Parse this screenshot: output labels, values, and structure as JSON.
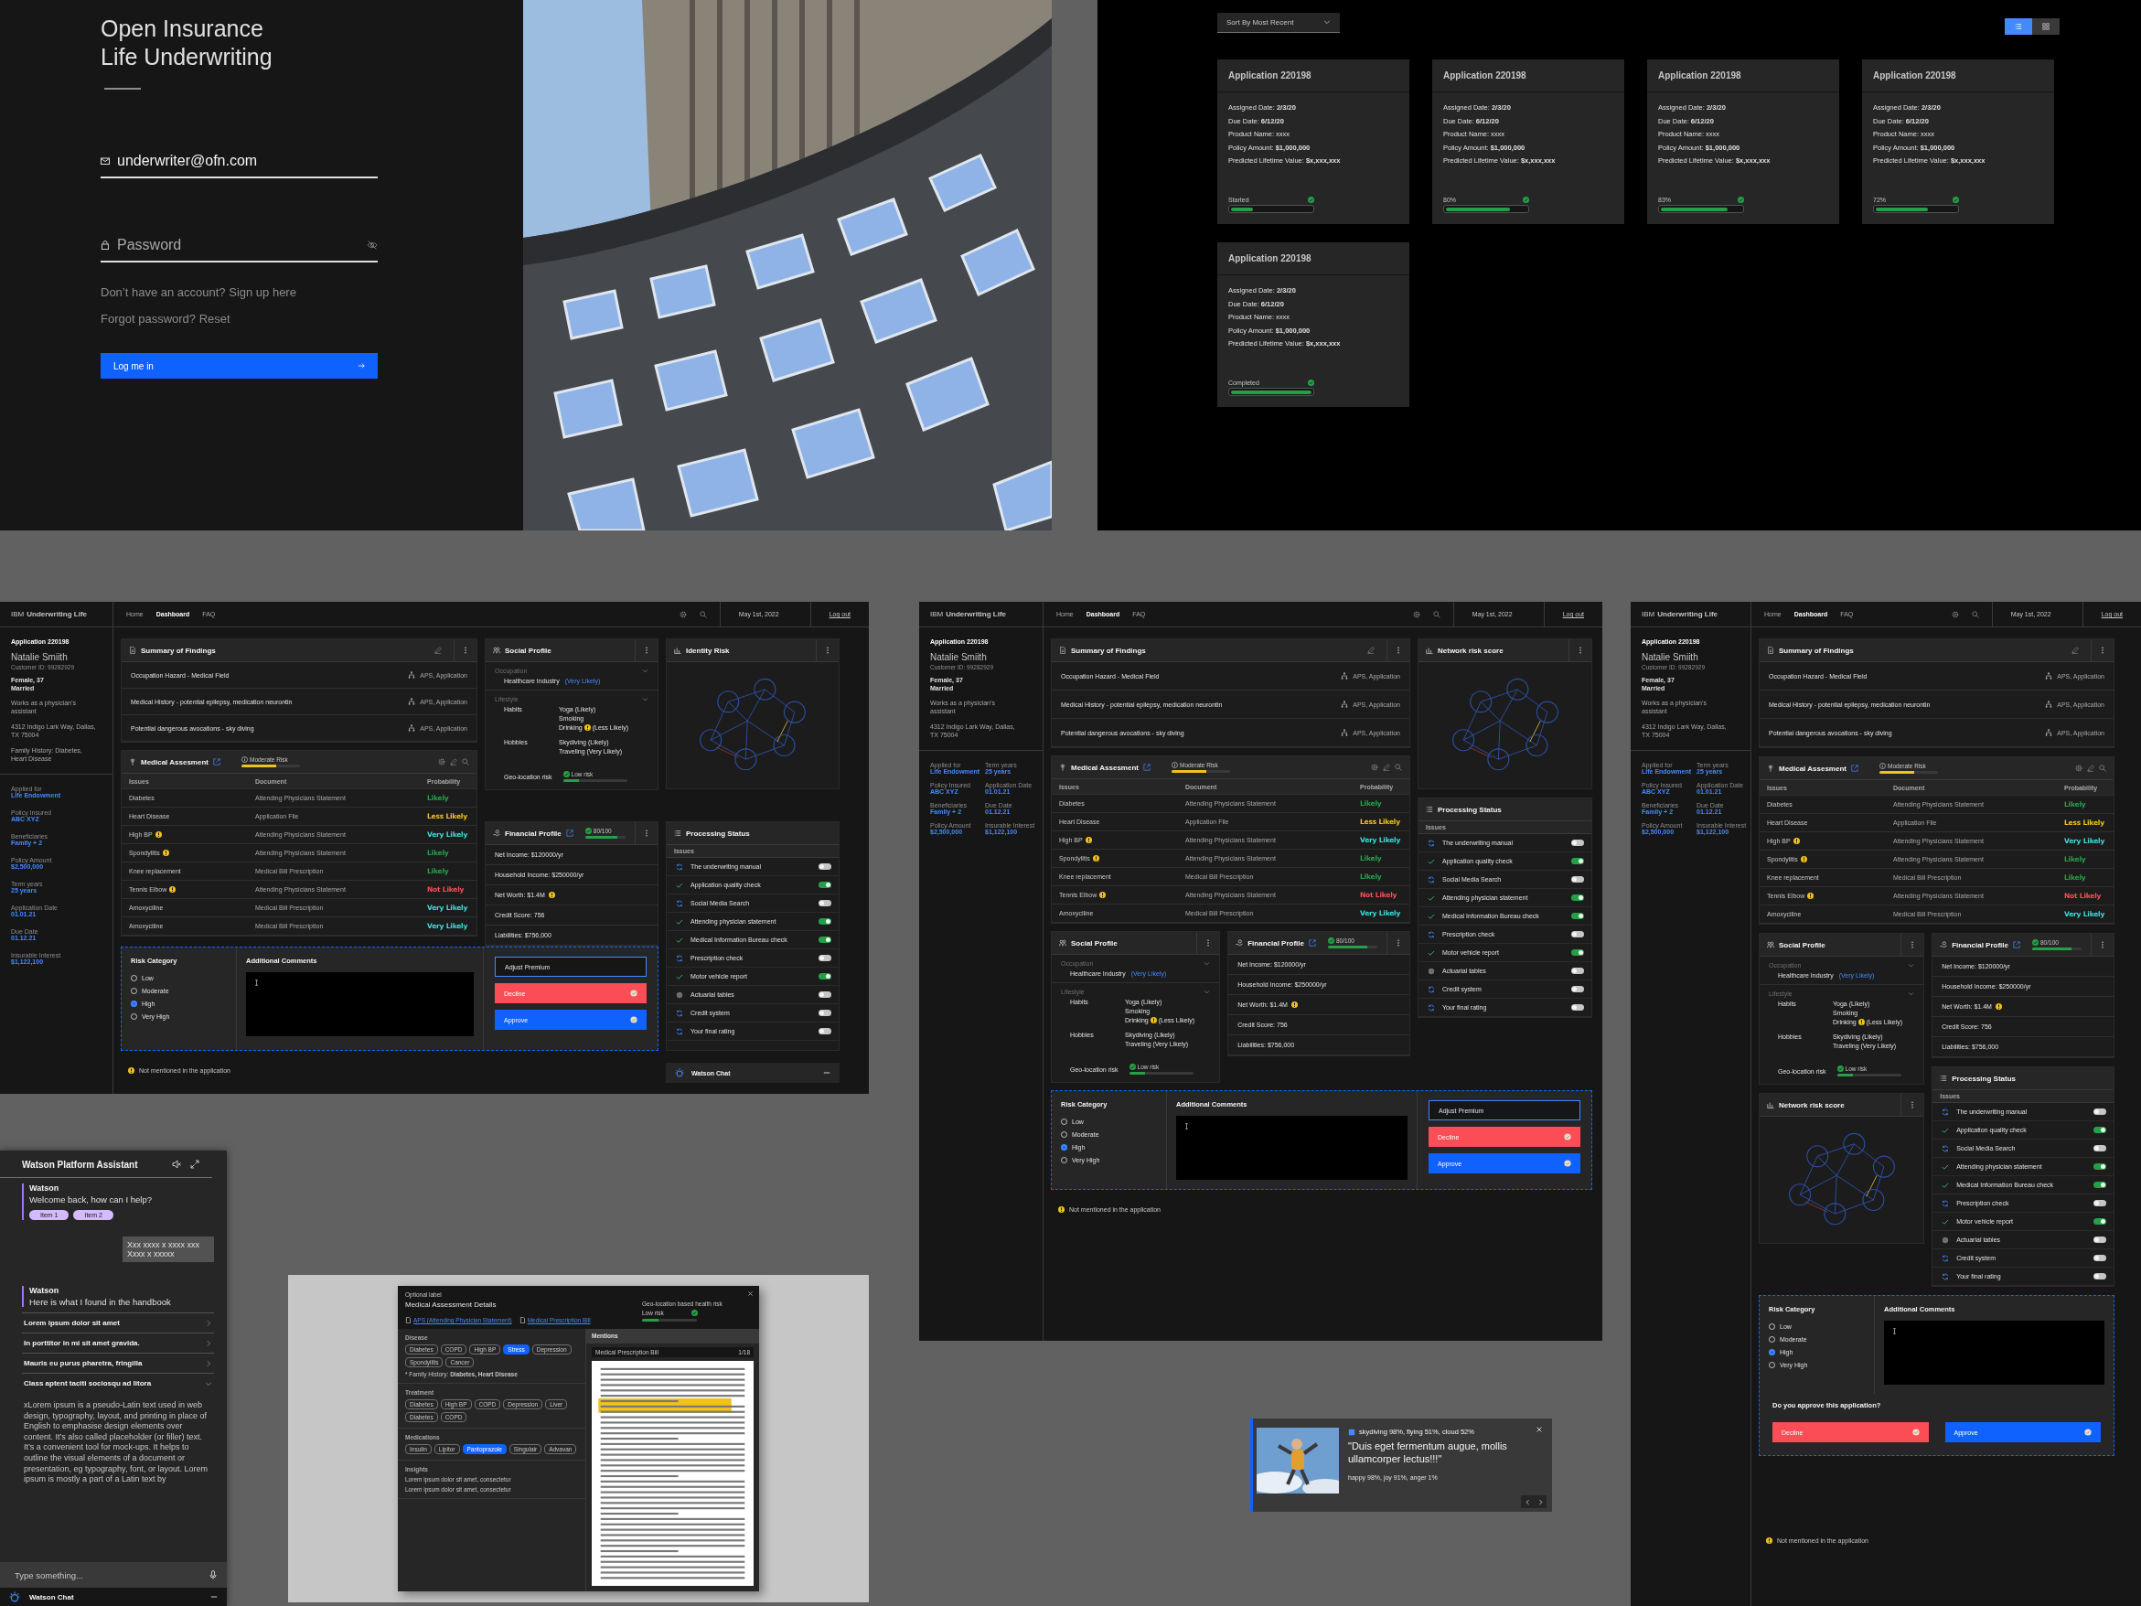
{
  "login": {
    "title_lines": [
      "Open Insurance",
      "Life Underwriting"
    ],
    "email": "underwriter@ofn.com",
    "password_placeholder": "Password",
    "links": [
      "Don’t have an account? Sign up here",
      "Forgot password? Reset"
    ],
    "button": "Log me in"
  },
  "applications": {
    "sort": "Sort By Most Recent",
    "views": [
      {
        "kind": "list",
        "selected": true
      },
      {
        "kind": "grid",
        "selected": false
      }
    ],
    "cards": [
      {
        "title": "Application 220198",
        "fields": [
          "Assigned Date: **2/3/20**",
          "Due Date: **6/12/20**",
          "Product Name: xxxx",
          "Policy Amount: **$1,000,000**",
          "Predicted Lifetime Value: **$x,xxx,xxx**"
        ],
        "progress": "Started",
        "level": 0.27
      },
      {
        "title": "Application 220198",
        "fields": [
          "Assigned Date: **2/3/20**",
          "Due Date: **6/12/20**",
          "Product Name: xxxx",
          "Policy Amount: **$1,000,000**",
          "Predicted Lifetime Value: **$x,xxx,xxx**"
        ],
        "progress": "80%",
        "level": 0.8
      },
      {
        "title": "Application 220198",
        "fields": [
          "Assigned Date: **2/3/20**",
          "Due Date: **6/12/20**",
          "Product Name: xxxx",
          "Policy Amount: **$1,000,000**",
          "Predicted Lifetime Value: **$x,xxx,xxx**"
        ],
        "progress": "83%",
        "level": 0.83
      },
      {
        "title": "Application 220198",
        "fields": [
          "Assigned Date: **2/3/20**",
          "Due Date: **6/12/20**",
          "Product Name: xxxx",
          "Policy Amount: **$1,000,000**",
          "Predicted Lifetime Value: **$x,xxx,xxx**"
        ],
        "progress": "72%",
        "level": 0.65
      },
      {
        "title": "Application 220198",
        "fields": [
          "Assigned Date: **2/3/20**",
          "Due Date: **6/12/20**",
          "Product Name: xxxx",
          "Policy Amount: **$1,000,000**",
          "Predicted Lifetime Value: **$x,xxx,xxx**"
        ],
        "progress": "Completed",
        "level": 1
      }
    ]
  },
  "dashboards": [
    {
      "kind": "wide",
      "nav": {
        "brand": "IBM **Underwriting Life**",
        "links": [
          {
            "label": "Home",
            "selected": false
          },
          {
            "label": "Dashboard",
            "selected": true
          },
          {
            "label": "FAQ",
            "selected": false
          }
        ],
        "date": "May 1st, 2022",
        "logout": "Log out"
      },
      "sidebar": {
        "application": "Application 220198",
        "name": "Natalie Smiith",
        "customer_id": "Customer ID: 99282929",
        "details": [
          "Female, 37",
          "Married"
        ],
        "occupation": "Works as a physician’s assistant",
        "address": "4312 Indigo Lark Way, Dallas, TX 75004",
        "family_history": "Family History: Diabetes, Heart Disease",
        "fields": [
          {
            "label": "Applied for",
            "value": "Life Endowment"
          },
          {
            "label": "Policy Insured",
            "value": "ABC XYZ"
          },
          {
            "label": "Beneficiaries",
            "value": "Family + 2"
          },
          {
            "label": "Policy Amount",
            "value": "$2,500,000"
          },
          {
            "label": "Term years",
            "value": "25 years"
          },
          {
            "label": "Application Date",
            "value": "01.01.21"
          },
          {
            "label": "Due Date",
            "value": "01.12.21"
          },
          {
            "label": "Insurable Interest",
            "value": "$1,122,100"
          }
        ]
      },
      "findings": {
        "title": "Summary of Findings",
        "rows": [
          {
            "text": "Occupation Hazard - Medical Field",
            "source": "APS, Application"
          },
          {
            "text": "Medical History - potential epilepsy, medication neurontin",
            "source": "APS, Application"
          },
          {
            "text": "Potential dangerous avocations - sky diving",
            "source": "APS, Application"
          }
        ]
      },
      "medical": {
        "title": "Medical Assesment",
        "risk": {
          "label": "Moderate Risk",
          "level": 0.6
        },
        "columns": [
          "Issues",
          "Document",
          "Probability"
        ],
        "rows": [
          {
            "issue": "Diabetes",
            "warning": false,
            "document": "Attending Physicians Statement",
            "probability": "Likely",
            "color": "#24a148"
          },
          {
            "issue": "Heart Disease",
            "warning": false,
            "document": "Application File",
            "probability": "Less Likely",
            "color": "#f1c21b"
          },
          {
            "issue": "High BP",
            "warning": true,
            "document": "Attending Physicians Statement",
            "probability": "Very Likely",
            "color": "#3ddbd9"
          },
          {
            "issue": "Spondylitis",
            "warning": true,
            "document": "Attending Physicians Statement",
            "probability": "Likely",
            "color": "#24a148"
          },
          {
            "issue": "Knee replacement",
            "warning": false,
            "document": "Medical Bill Prescription",
            "probability": "Likely",
            "color": "#24a148"
          },
          {
            "issue": "Tennis Elbow",
            "warning": true,
            "document": "Attending Physicians Statement",
            "probability": "Not Likely",
            "color": "#fa4d56"
          },
          {
            "issue": "Amoxyciline",
            "warning": false,
            "document": "Medical Bill Prescription",
            "probability": "Very Likely",
            "color": "#3ddbd9"
          },
          {
            "issue": "Amoxyciline",
            "warning": false,
            "document": "Medical Bill Prescription",
            "probability": "Very Likely",
            "color": "#3ddbd9"
          }
        ]
      },
      "social": {
        "title": "Social Profile",
        "occupation_label": "Occupation",
        "occupation": "Healthcare Industry",
        "occupation_note": "(Very Likely)",
        "lifestyle_label": "Lifestyle",
        "groups": [
          {
            "label": "Habits",
            "items": [
              {
                "text": "Yoga (Likely)",
                "warning": false
              },
              {
                "text": "Smoking",
                "warning": false
              },
              {
                "text": "Drinking",
                "warning": true,
                "note": "(Less Likely)"
              }
            ]
          },
          {
            "label": "Hobbies",
            "items": [
              {
                "text": "Skydiving (Likely)",
                "warning": false
              },
              {
                "text": "Traveling  (Very Likely)",
                "warning": false
              }
            ]
          }
        ],
        "geo": {
          "label": "Geo-location risk",
          "risk": "Low risk",
          "level": 0.25
        }
      },
      "financial": {
        "title": "Financial Profile",
        "score": "80/100",
        "level": 0.8,
        "rows": [
          {
            "text": "Net Income: $120000/yr",
            "warning": false
          },
          {
            "text": "Household Income: $250000/yr",
            "warning": false
          },
          {
            "text": "Net Worth: $1.4M",
            "warning": true
          },
          {
            "text": "Credit Score: 756",
            "warning": false
          },
          {
            "text": "Liabilities: $756,000",
            "warning": false
          }
        ]
      },
      "network": {
        "title": "Identity Risk"
      },
      "processing": {
        "title": "Processing Status",
        "header": "Issues",
        "items": [
          {
            "label": "The underwriting manual",
            "kind": "sync",
            "on": false
          },
          {
            "label": "Application quality check",
            "kind": "done",
            "on": true
          },
          {
            "label": "Social Media Search",
            "kind": "sync",
            "on": false
          },
          {
            "label": "Attending physician statement",
            "kind": "done",
            "on": true
          },
          {
            "label": "Medical Information Bureau check",
            "kind": "done",
            "on": true
          },
          {
            "label": "Prescription check",
            "kind": "sync",
            "on": false
          },
          {
            "label": "Motor vehicle report",
            "kind": "done",
            "on": true
          },
          {
            "label": "Actuarial tables",
            "kind": "pending",
            "on": false
          },
          {
            "label": "Credit system",
            "kind": "sync",
            "on": false
          },
          {
            "label": "Your final rating",
            "kind": "sync",
            "on": false
          }
        ]
      },
      "decision": {
        "risk_title": "Risk Category",
        "options": [
          {
            "label": "Low",
            "selected": false
          },
          {
            "label": "Moderate",
            "selected": false
          },
          {
            "label": "High",
            "selected": true
          },
          {
            "label": "Very High",
            "selected": false
          }
        ],
        "comments_title": "Additional Comments",
        "buttons": [
          {
            "kind": "outline",
            "label": "Adjust Premium"
          },
          {
            "kind": "danger",
            "label": "Decline"
          },
          {
            "kind": "primary",
            "label": "Approve"
          }
        ]
      },
      "footnote": "Not mentioned in the application",
      "chat": "Watson Chat"
    },
    {
      "kind": "stack",
      "nav": {
        "brand": "IBM **Underwriting Life**",
        "links": [
          {
            "label": "Home",
            "selected": false
          },
          {
            "label": "Dashboard",
            "selected": true
          },
          {
            "label": "FAQ",
            "selected": false
          }
        ],
        "date": "May 1st, 2022",
        "logout": "Log out"
      },
      "sidebar": {
        "application": "Application 220198",
        "name": "Natalie Smiith",
        "customer_id": "Customer ID: 99282929",
        "details": [
          "Female, 37",
          "Married"
        ],
        "occupation": "Works as a physician’s assistant",
        "address": "4312 Indigo Lark Way, Dallas, TX 75004",
        "fields": [
          {
            "label": "Applied for",
            "value": "Life Endowment"
          },
          {
            "label": "Policy Insured",
            "value": "ABC XYZ"
          },
          {
            "label": "Beneficiaries",
            "value": "Family + 2"
          },
          {
            "label": "Policy Amount",
            "value": "$2,500,000"
          },
          {
            "label": "Term years",
            "value": "25 years"
          },
          {
            "label": "Application Date",
            "value": "01.01.21"
          },
          {
            "label": "Due Date",
            "value": "01.12.21"
          },
          {
            "label": "Insurable Interest",
            "value": "$1,122,100"
          }
        ]
      },
      "findings": {
        "title": "Summary of Findings",
        "rows": [
          {
            "text": "Occupation Hazard - Medical Field",
            "source": "APS, Application"
          },
          {
            "text": "Medical History - potential epilepsy, medication neurontin",
            "source": "APS, Application"
          },
          {
            "text": "Potential dangerous avocations - sky diving",
            "source": "APS, Application"
          }
        ]
      },
      "medical": {
        "title": "Medical Assesment",
        "risk": {
          "label": "Moderate Risk",
          "level": 0.6
        },
        "columns": [
          "Issues",
          "Document",
          "Probability"
        ],
        "rows": [
          {
            "issue": "Diabetes",
            "warning": false,
            "document": "Attending Physicians Statement",
            "probability": "Likely",
            "color": "#24a148"
          },
          {
            "issue": "Heart Disease",
            "warning": false,
            "document": "Application File",
            "probability": "Less Likely",
            "color": "#f1c21b"
          },
          {
            "issue": "High BP",
            "warning": true,
            "document": "Attending Physicians Statement",
            "probability": "Very Likely",
            "color": "#3ddbd9"
          },
          {
            "issue": "Spondylitis",
            "warning": true,
            "document": "Attending Physicians Statement",
            "probability": "Likely",
            "color": "#24a148"
          },
          {
            "issue": "Knee replacement",
            "warning": false,
            "document": "Medical Bill Prescription",
            "probability": "Likely",
            "color": "#24a148"
          },
          {
            "issue": "Tennis Elbow",
            "warning": true,
            "document": "Attending Physicians Statement",
            "probability": "Not Likely",
            "color": "#fa4d56"
          },
          {
            "issue": "Amoxyciline",
            "warning": false,
            "document": "Medical Bill Prescription",
            "probability": "Very Likely",
            "color": "#3ddbd9"
          }
        ]
      },
      "social": {
        "title": "Social Profile",
        "occupation_label": "Occupation",
        "occupation": "Healthcare Industry",
        "occupation_note": "(Very Likely)",
        "lifestyle_label": "Lifestyle",
        "groups": [
          {
            "label": "Habits",
            "items": [
              {
                "text": "Yoga (Likely)",
                "warning": false
              },
              {
                "text": "Smoking",
                "warning": false
              },
              {
                "text": "Drinking",
                "warning": true,
                "note": "(Less Likely)"
              }
            ]
          },
          {
            "label": "Hobbies",
            "items": [
              {
                "text": "Skydiving (Likely)",
                "warning": false
              },
              {
                "text": "Traveling  (Very Likely)",
                "warning": false
              }
            ]
          }
        ],
        "geo": {
          "label": "Geo-location risk",
          "risk": "Low risk",
          "level": 0.25
        }
      },
      "financial": {
        "title": "Financial Profile",
        "score": "80/100",
        "level": 0.8,
        "rows": [
          {
            "text": "Net Income: $120000/yr",
            "warning": false
          },
          {
            "text": "Household Income: $250000/yr",
            "warning": false
          },
          {
            "text": "Net Worth: $1.4M",
            "warning": true
          },
          {
            "text": "Credit Score: 756",
            "warning": false
          },
          {
            "text": "Liabilities: $756,000",
            "warning": false
          }
        ]
      },
      "network": {
        "title": "Network risk score"
      },
      "processing": {
        "title": "Processing Status",
        "header": "Issues",
        "items": [
          {
            "label": "The underwriting manual",
            "kind": "sync",
            "on": false
          },
          {
            "label": "Application quality check",
            "kind": "done",
            "on": true
          },
          {
            "label": "Social Media Search",
            "kind": "sync",
            "on": false
          },
          {
            "label": "Attending physician statement",
            "kind": "done",
            "on": true
          },
          {
            "label": "Medical Information Bureau check",
            "kind": "done",
            "on": true
          },
          {
            "label": "Prescription check",
            "kind": "sync",
            "on": false
          },
          {
            "label": "Motor vehicle report",
            "kind": "done",
            "on": true
          },
          {
            "label": "Actuarial tables",
            "kind": "pending",
            "on": false
          },
          {
            "label": "Credit system",
            "kind": "sync",
            "on": false
          },
          {
            "label": "Your final rating",
            "kind": "sync",
            "on": false
          }
        ]
      },
      "decision": {
        "risk_title": "Risk Category",
        "options": [
          {
            "label": "Low",
            "selected": false
          },
          {
            "label": "Moderate",
            "selected": false
          },
          {
            "label": "High",
            "selected": true
          },
          {
            "label": "Very High",
            "selected": false
          }
        ],
        "comments_title": "Additional Comments",
        "buttons": [
          {
            "kind": "outline",
            "label": "Adjust Premium"
          },
          {
            "kind": "danger",
            "label": "Decline"
          },
          {
            "kind": "primary",
            "label": "Approve"
          }
        ]
      },
      "footnote": "Not mentioned in the application"
    },
    {
      "kind": "narrow",
      "nav": {
        "brand": "IBM **Underwriting Life**",
        "links": [
          {
            "label": "Home",
            "selected": false
          },
          {
            "label": "Dashboard",
            "selected": true
          },
          {
            "label": "FAQ",
            "selected": false
          }
        ],
        "date": "May 1st, 2022",
        "logout": "Log out"
      },
      "sidebar": {
        "application": "Application 220198",
        "name": "Natalie Smiith",
        "customer_id": "Customer ID: 99282929",
        "details": [
          "Female, 37",
          "Married"
        ],
        "occupation": "Works as a physician’s assistant",
        "address": "4312 Indigo Lark Way, Dallas, TX 75004",
        "fields": [
          {
            "label": "Applied for",
            "value": "Life Endowment"
          },
          {
            "label": "Policy Insured",
            "value": "ABC XYZ"
          },
          {
            "label": "Beneficiaries",
            "value": "Family + 2"
          },
          {
            "label": "Policy Amount",
            "value": "$2,500,000"
          },
          {
            "label": "Term years",
            "value": "25 years"
          },
          {
            "label": "Application Date",
            "value": "01.01.21"
          },
          {
            "label": "Due Date",
            "value": "01.12.21"
          },
          {
            "label": "Insurable Interest",
            "value": "$1,122,100"
          }
        ]
      },
      "findings": {
        "title": "Summary of Findings",
        "rows": [
          {
            "text": "Occupation Hazard - Medical Field",
            "source": "APS, Application"
          },
          {
            "text": "Medical History - potential epilepsy, medication neurontin",
            "source": "APS, Application"
          },
          {
            "text": "Potential dangerous avocations - sky diving",
            "source": "APS, Application"
          }
        ]
      },
      "medical": {
        "title": "Medical Assesment",
        "risk": {
          "label": "Moderate Risk",
          "level": 0.6
        },
        "columns": [
          "Issues",
          "Document",
          "Probability"
        ],
        "rows": [
          {
            "issue": "Diabetes",
            "warning": false,
            "document": "Attending Physicians Statement",
            "probability": "Likely",
            "color": "#24a148"
          },
          {
            "issue": "Heart Disease",
            "warning": false,
            "document": "Application File",
            "probability": "Less Likely",
            "color": "#f1c21b"
          },
          {
            "issue": "High BP",
            "warning": true,
            "document": "Attending Physicians Statement",
            "probability": "Very Likely",
            "color": "#3ddbd9"
          },
          {
            "issue": "Spondylitis",
            "warning": true,
            "document": "Attending Physicians Statement",
            "probability": "Likely",
            "color": "#24a148"
          },
          {
            "issue": "Knee replacement",
            "warning": false,
            "document": "Medical Bill Prescription",
            "probability": "Likely",
            "color": "#24a148"
          },
          {
            "issue": "Tennis Elbow",
            "warning": true,
            "document": "Attending Physicians Statement",
            "probability": "Not Likely",
            "color": "#fa4d56"
          },
          {
            "issue": "Amoxyciline",
            "warning": false,
            "document": "Medical Bill Prescription",
            "probability": "Very Likely",
            "color": "#3ddbd9"
          }
        ]
      },
      "social": {
        "title": "Social Profile",
        "occupation_label": "Occupation",
        "occupation": "Healthcare Industry",
        "occupation_note": "(Very Likely)",
        "lifestyle_label": "Lifestyle",
        "groups": [
          {
            "label": "Habits",
            "items": [
              {
                "text": "Yoga (Likely)",
                "warning": false
              },
              {
                "text": "Smoking",
                "warning": false
              },
              {
                "text": "Drinking",
                "warning": true,
                "note": "(Less Likely)"
              }
            ]
          },
          {
            "label": "Hobbies",
            "items": [
              {
                "text": "Skydiving (Likely)",
                "warning": false
              },
              {
                "text": "Traveling  (Very Likely)",
                "warning": false
              }
            ]
          }
        ],
        "geo": {
          "label": "Geo-location risk",
          "risk": "Low risk",
          "level": 0.25
        }
      },
      "financial": {
        "title": "Financial Profile",
        "score": "80/100",
        "level": 0.8,
        "rows": [
          {
            "text": "Net Income: $120000/yr",
            "warning": false
          },
          {
            "text": "Household Income: $250000/yr",
            "warning": false
          },
          {
            "text": "Net Worth: $1.4M",
            "warning": true
          },
          {
            "text": "Credit Score: 756",
            "warning": false
          },
          {
            "text": "Liabilities: $756,000",
            "warning": false
          }
        ]
      },
      "network": {
        "title": "Network risk score"
      },
      "processing": {
        "title": "Processing Status",
        "header": "Issues",
        "items": [
          {
            "label": "The underwriting manual",
            "kind": "sync",
            "on": false
          },
          {
            "label": "Application quality check",
            "kind": "done",
            "on": true
          },
          {
            "label": "Social Media Search",
            "kind": "sync",
            "on": false
          },
          {
            "label": "Attending physician statement",
            "kind": "done",
            "on": true
          },
          {
            "label": "Medical Information Bureau check",
            "kind": "done",
            "on": true
          },
          {
            "label": "Prescription check",
            "kind": "sync",
            "on": false
          },
          {
            "label": "Motor vehicle report",
            "kind": "done",
            "on": true
          },
          {
            "label": "Actuarial tables",
            "kind": "pending",
            "on": false
          },
          {
            "label": "Credit system",
            "kind": "sync",
            "on": false
          },
          {
            "label": "Your final rating",
            "kind": "sync",
            "on": false
          }
        ]
      },
      "decision": {
        "risk_title": "Risk Category",
        "options": [
          {
            "label": "Low",
            "selected": false
          },
          {
            "label": "Moderate",
            "selected": false
          },
          {
            "label": "High",
            "selected": true
          },
          {
            "label": "Very High",
            "selected": false
          }
        ],
        "comments_title": "Additional Comments",
        "question": "Do you approve this application?",
        "buttons": [
          {
            "kind": "danger",
            "label": "Decline"
          },
          {
            "kind": "primary",
            "label": "Approve"
          }
        ]
      },
      "footnote": "Not mentioned in the application"
    }
  ],
  "assistant": {
    "title": "Watson Platform Assistant",
    "messages": [
      {
        "kind": "bot",
        "sender": "Watson",
        "text": "Welcome back, how can I help?",
        "chips": [
          "Item 1",
          "Item 2"
        ]
      },
      {
        "kind": "user",
        "text": "Xxx xxxx x xxxx xxx Xxxx x xxxxx"
      },
      {
        "kind": "bot",
        "sender": "Watson",
        "text": "Here is what I found in the handbook"
      },
      {
        "kind": "accordion",
        "items": [
          {
            "title": "Lorem ipsum dolor sit amet",
            "expanded": false
          },
          {
            "title": "In porttitor in mi sit amet gravida.",
            "expanded": false
          },
          {
            "title": "Mauris eu purus pharetra, fringilla",
            "expanded": false
          },
          {
            "title": "Class aptent taciti sociosqu ad litora",
            "expanded": true,
            "body": "xLorem ipsum is a pseudo-Latin text used in web design, typography, layout, and printing in place of English to emphasise design elements over content. It’s also called placeholder (or filler) text. It’s a convenient tool for mock-ups. It helps to outline the visual elements of a document or presentation, eg typography, font, or layout. Lorem ipsum is mostly a part of a Latin text by"
          }
        ]
      }
    ],
    "input_placeholder": "Type something...",
    "footer": "Watson Chat"
  },
  "modal": {
    "label": "Optional label",
    "title": "Medical Assessment Details",
    "links": [
      "APS (Attending Physician Statement)",
      "Medical Prescription Bill"
    ],
    "risk_title": "Geo-location based health risk",
    "risk": {
      "label": "Low risk",
      "level": 0.3
    },
    "sections": [
      {
        "title": "Disease",
        "tags": [
          {
            "label": "Diabetes",
            "selected": false
          },
          {
            "label": "COPD",
            "selected": false
          },
          {
            "label": "High BP",
            "selected": false
          },
          {
            "label": "Stress",
            "selected": true
          },
          {
            "label": "Depression",
            "selected": false
          },
          {
            "label": "Spondylitis",
            "selected": false
          },
          {
            "label": "Cancer",
            "selected": false
          }
        ],
        "note": "* Family History: **Diabetes, Heart Disease**"
      },
      {
        "title": "Treatment",
        "tags": [
          {
            "label": "Diabetes",
            "selected": false
          },
          {
            "label": "High BP",
            "selected": false
          },
          {
            "label": "COPD",
            "selected": false
          },
          {
            "label": "Depression",
            "selected": false
          },
          {
            "label": "Liver",
            "selected": false
          },
          {
            "label": "Diabetes",
            "selected": false
          },
          {
            "label": "COPD",
            "selected": false
          }
        ]
      },
      {
        "title": "Medications",
        "tags": [
          {
            "label": "Insulin",
            "selected": false
          },
          {
            "label": "Lipitor",
            "selected": false
          },
          {
            "label": "Pantoprazole",
            "selected": true
          },
          {
            "label": "Singulair",
            "selected": false
          },
          {
            "label": "Advavan",
            "selected": false
          }
        ]
      },
      {
        "title": "Insights",
        "lines": [
          "Lorem ipsum dolor sit amet, consectetur",
          "Lorem ipsum dolor sit amet, consectetur"
        ]
      }
    ],
    "mentions": "Mentions",
    "document": "Medical Prescription Bill",
    "pager": "1/18"
  },
  "notification": {
    "tags": "skydiving 98%, flying 51%, cloud 52%",
    "quote": "\"Duis eget fermentum augue, mollis ullamcorper lectus!!!\"",
    "emotions": "happy 98%, joy 91%, anger 1%"
  }
}
